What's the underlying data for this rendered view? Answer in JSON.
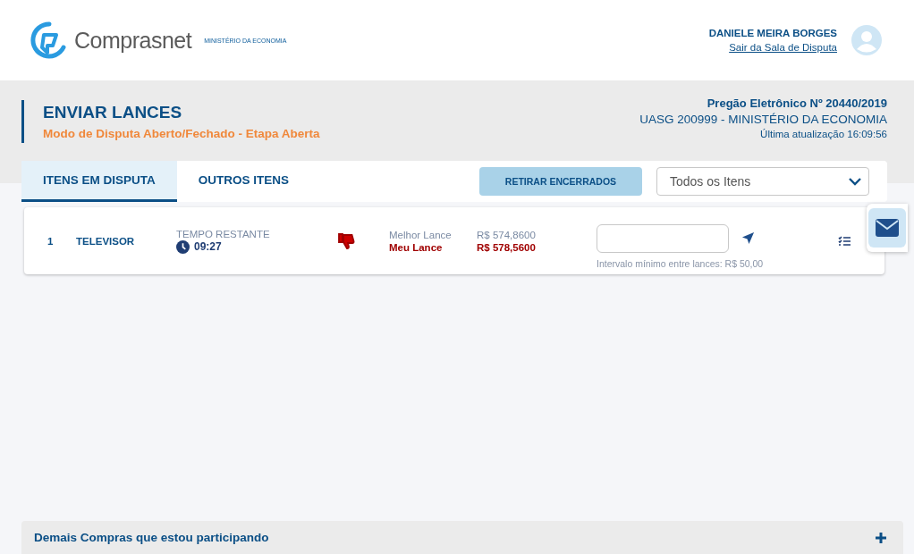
{
  "header": {
    "logo_text": "Comprasnet",
    "ministry": "MINISTÉRIO DA ECONOMIA",
    "user_name": "DANIELE MEIRA BORGES",
    "logout_link": "Sair da Sala de Disputa"
  },
  "page": {
    "title": "ENVIAR LANCES",
    "subtitle": "Modo de Disputa Aberto/Fechado - Etapa Aberta",
    "auction": "Pregão Eletrônico Nº 20440/2019",
    "uasg": "UASG 200999 - MINISTÉRIO DA ECONOMIA",
    "updated": "Última atualização 16:09:56"
  },
  "tabs": [
    {
      "label": "ITENS EM DISPUTA",
      "selected": true
    },
    {
      "label": "OUTROS ITENS",
      "selected": false
    }
  ],
  "remove_button": "RETIRAR ENCERRADOS",
  "filter": {
    "value": "Todos os Itens"
  },
  "items": [
    {
      "number": "1",
      "name": "TELEVISOR",
      "time_label": "TEMPO RESTANTE",
      "time": "09:27",
      "winning": false,
      "best_label": "Melhor Lance",
      "best_value": "R$ 574,8600",
      "my_label": "Meu Lance",
      "my_value": "R$ 578,5600",
      "bid_hint": "Intervalo mínimo entre lances: R$ 50,00"
    }
  ],
  "footer": {
    "label": "Demais Compras que estou participando",
    "expanded": false
  }
}
